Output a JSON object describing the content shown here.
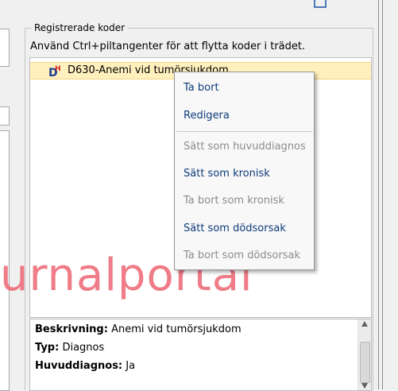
{
  "panel": {
    "legend": "Registrerade koder",
    "hint": "Använd Ctrl+piltangenter för att flytta koder i trädet."
  },
  "tree": {
    "items": [
      {
        "label": "D630-Anemi vid tumörsjukdom",
        "icon": "diagnosis-dh-icon",
        "selected": true
      }
    ]
  },
  "context_menu": {
    "items": [
      {
        "label": "Ta bort",
        "enabled": true
      },
      {
        "label": "Redigera",
        "enabled": true
      },
      {
        "label": "Sätt som huvuddiagnos",
        "enabled": false
      },
      {
        "label": "Sätt som kronisk",
        "enabled": true
      },
      {
        "label": "Ta bort som kronisk",
        "enabled": false
      },
      {
        "label": "Sätt som dödsorsak",
        "enabled": true
      },
      {
        "label": "Ta bort som dödsorsak",
        "enabled": false
      }
    ]
  },
  "watermark": "urnalportal",
  "details": {
    "beskrivning_label": "Beskrivning:",
    "beskrivning_value": "Anemi vid tumörsjukdom",
    "typ_label": "Typ:",
    "typ_value": "Diagnos",
    "huvuddiagnos_label": "Huvuddiagnos:",
    "huvuddiagnos_value": "Ja"
  },
  "colors": {
    "selected_row": "#fff0bd",
    "menu_enabled": "#0d3b7a",
    "menu_disabled": "#8c8c8c",
    "watermark": "#ee6e7b"
  }
}
